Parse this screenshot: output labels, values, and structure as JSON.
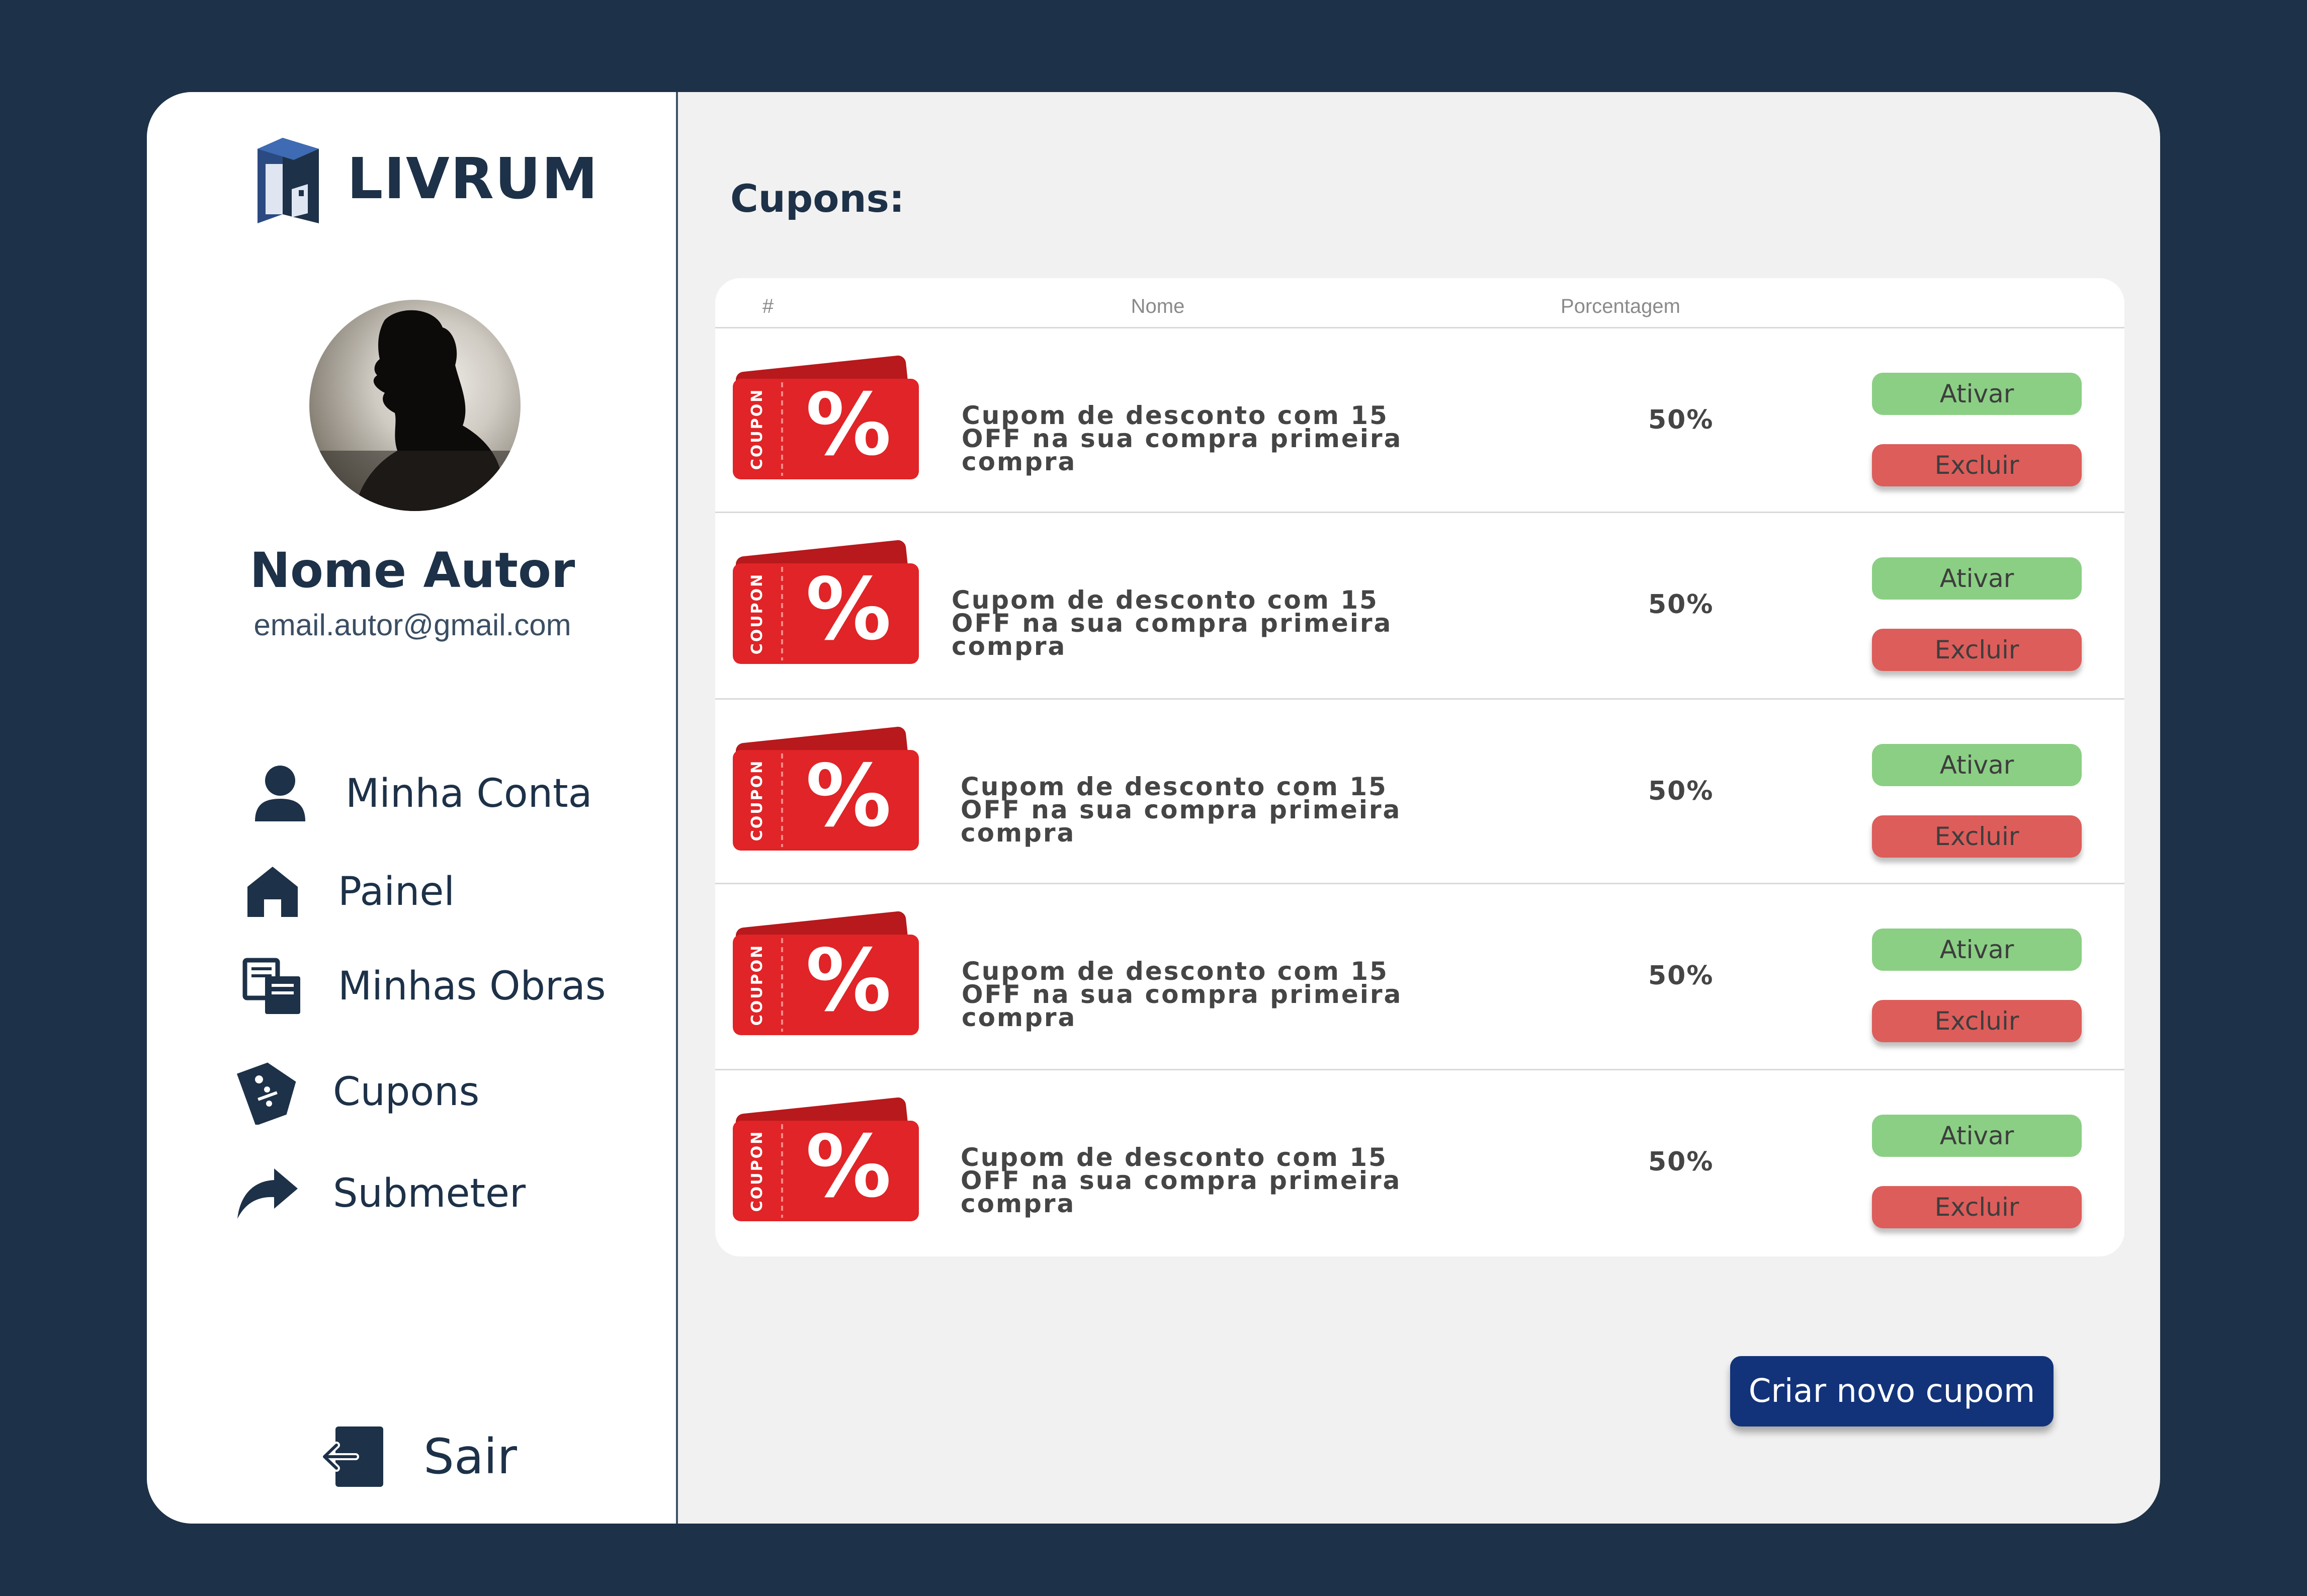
{
  "brand": {
    "name": "LIVRUM"
  },
  "profile": {
    "name": "Nome Autor",
    "email": "email.autor@gmail.com"
  },
  "nav": {
    "items": [
      {
        "label": "Minha Conta",
        "icon": "user-icon"
      },
      {
        "label": "Painel",
        "icon": "home-icon"
      },
      {
        "label": "Minhas Obras",
        "icon": "books-icon"
      },
      {
        "label": "Cupons",
        "icon": "discount-tag-icon"
      },
      {
        "label": "Submeter",
        "icon": "share-arrow-icon"
      }
    ],
    "logout": {
      "label": "Sair",
      "icon": "logout-icon"
    }
  },
  "main": {
    "title": "Cupons:",
    "table": {
      "headers": {
        "index": "#",
        "name": "Nome",
        "percent": "Porcentagem"
      },
      "rows": [
        {
          "name": "Cupom de desconto com 15 OFF na sua compra primeira compra",
          "percent": "50%",
          "activate_label": "Ativar",
          "delete_label": "Excluir",
          "image_text": "COUPON"
        },
        {
          "name": "Cupom de desconto com 15 OFF na sua compra primeira compra",
          "percent": "50%",
          "activate_label": "Ativar",
          "delete_label": "Excluir",
          "image_text": "COUPON"
        },
        {
          "name": "Cupom de desconto com 15 OFF na sua compra primeira compra",
          "percent": "50%",
          "activate_label": "Ativar",
          "delete_label": "Excluir",
          "image_text": "COUPON"
        },
        {
          "name": "Cupom de desconto com 15 OFF na sua compra primeira compra",
          "percent": "50%",
          "activate_label": "Ativar",
          "delete_label": "Excluir",
          "image_text": "COUPON"
        },
        {
          "name": "Cupom de desconto com 15 OFF na sua compra primeira compra",
          "percent": "50%",
          "activate_label": "Ativar",
          "delete_label": "Excluir",
          "image_text": "COUPON"
        }
      ]
    },
    "create_button": "Criar novo cupom"
  },
  "colors": {
    "background": "#1d3148",
    "primary_text": "#1d3148",
    "activate": "#8bcf84",
    "delete": "#dd5d5a",
    "create": "#12337a",
    "coupon_red": "#e02427"
  }
}
